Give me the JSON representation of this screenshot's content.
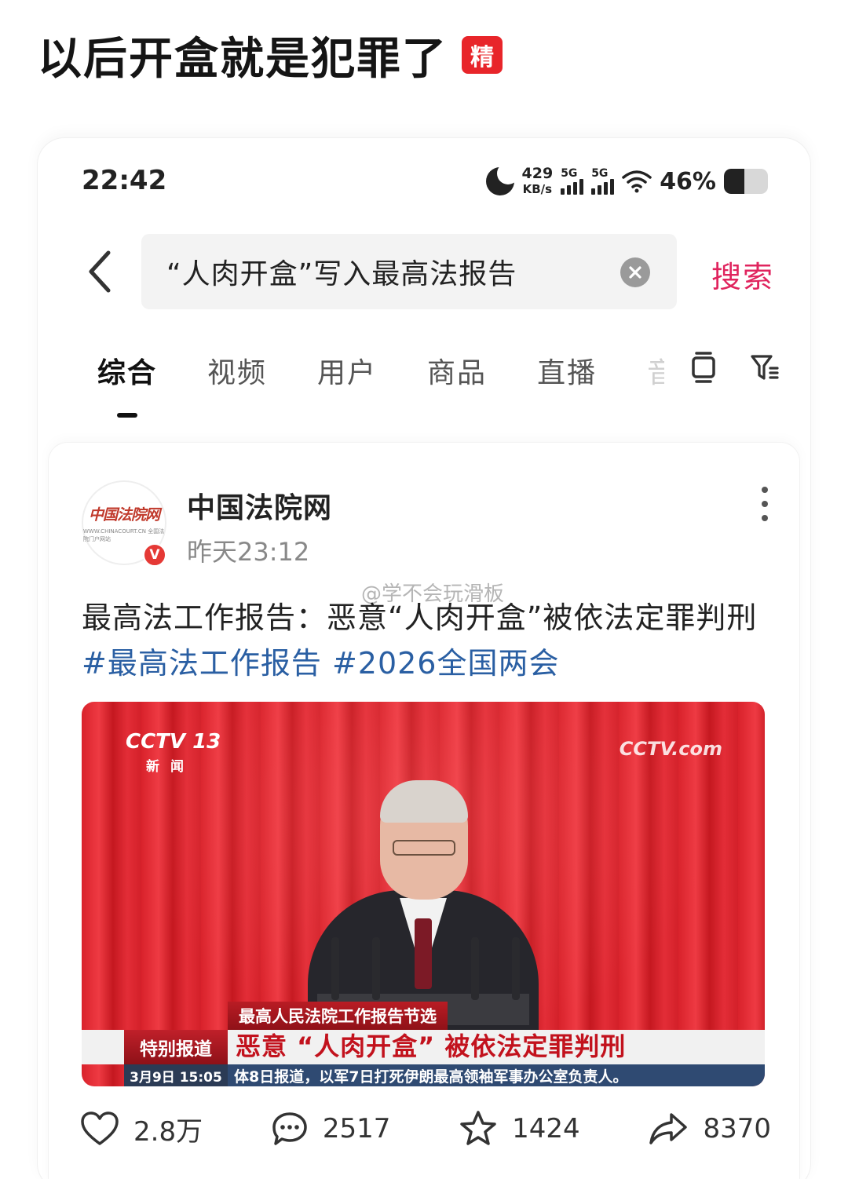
{
  "post": {
    "title": "以后开盒就是犯罪了",
    "badge": "精"
  },
  "status_bar": {
    "time": "22:42",
    "net_speed_value": "429",
    "net_speed_unit": "KB/s",
    "sim1": "5G",
    "sim2": "5G",
    "battery_pct": "46%",
    "battery_level": 0.46
  },
  "search": {
    "query": "“人肉开盒”写入最高法报告",
    "submit_label": "搜索"
  },
  "tabs": [
    {
      "label": "综合",
      "active": true
    },
    {
      "label": "视频"
    },
    {
      "label": "用户"
    },
    {
      "label": "商品"
    },
    {
      "label": "直播"
    },
    {
      "label": "音"
    }
  ],
  "result": {
    "author": "中国法院网",
    "avatar_logo": "中国法院网",
    "avatar_sub": "WWW.CHINACOURT.CN 全国法院门户网站",
    "verified_mark": "V",
    "time": "昨天23:12",
    "watermark": "@学不会玩滑板",
    "text": "最高法工作报告：恶意“人肉开盒”被依法定罪判刑",
    "hashtags": [
      "#最高法工作报告",
      "#2026全国两会"
    ],
    "video": {
      "channel": "CCTV 13",
      "channel_sub": "新闻",
      "site_logo": "CCTV.com",
      "lower_third_top": "最高人民法院工作报告节选",
      "special_tag": "特别报道",
      "headline": "恶意 “人肉开盒”  被依法定罪判刑",
      "date_time": "3月9日  15:05",
      "ticker": "体8日报道，以军7日打死伊朗最高领袖军事办公室负责人。"
    },
    "actions": {
      "likes": "2.8万",
      "comments": "2517",
      "favorites": "1424",
      "shares": "8370"
    }
  }
}
